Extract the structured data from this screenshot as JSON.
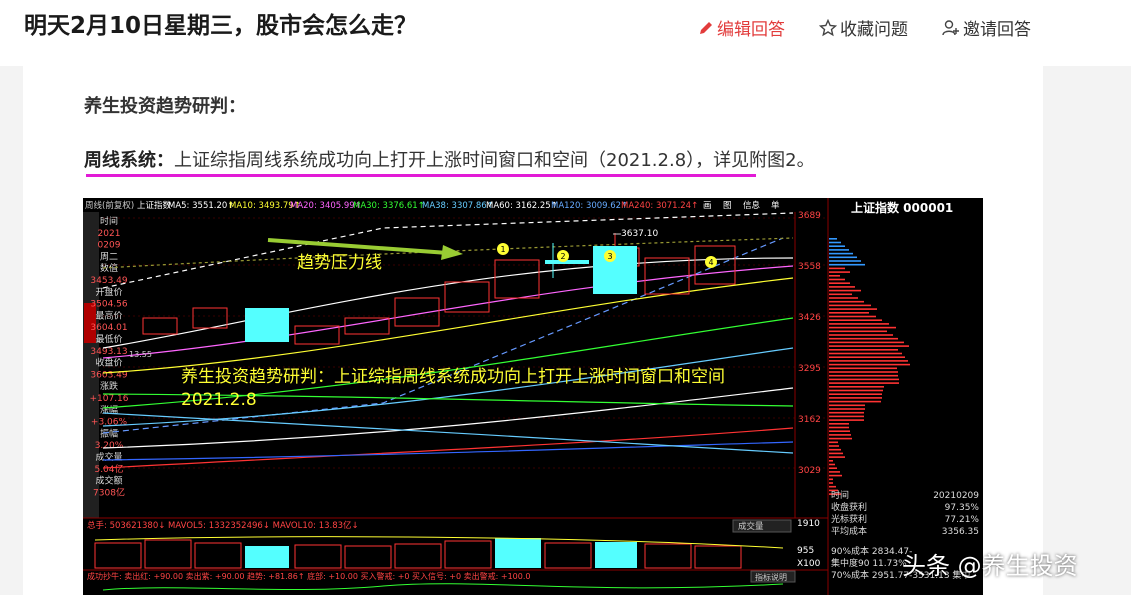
{
  "question": {
    "title": "明天2月10日星期三，股市会怎么走？"
  },
  "actions": {
    "edit": "编辑回答",
    "collect": "收藏问题",
    "invite": "邀请回答"
  },
  "article": {
    "heading": "养生投资趋势研判：",
    "line_bold": "周线系统：",
    "line_text": "上证综指周线系统成功向上打开上涨时间窗口和空间（2021.2.8）",
    "line_tail": "，详见附图2。"
  },
  "chart": {
    "header_left": "周线(前复权)",
    "header_name": "上证指数",
    "ma": [
      "MA5: 3551.20↑",
      "MA10: 3493.79↑",
      "MA20: 3405.99↑",
      "MA30: 3376.61↑",
      "MA38: 3307.86↑",
      "MA60: 3162.25↑",
      "MA120: 3009.62↑",
      "MA240: 3071.24↑"
    ],
    "tabs": [
      "画",
      "图",
      "信息",
      "单"
    ],
    "side_info": [
      "时间",
      "2021",
      "0209",
      "周二",
      "数值",
      "3453.49",
      "开盘价",
      "3504.56",
      "最高价",
      "3604.01",
      "最低价",
      "3493.13",
      "收盘价",
      "3603.49",
      "涨跌",
      "+107.16",
      "涨幅",
      "+3.06%",
      "振幅",
      "3.20%",
      "成交量",
      "5.04亿",
      "成交额",
      "7308亿"
    ],
    "y_ticks": [
      "3689",
      "3558",
      "3426",
      "3295",
      "3162",
      "3029"
    ],
    "price_label": "3637.10",
    "low_label": "13.55",
    "trend_label": "趋势压力线",
    "overlay_line1": "养生投资趋势研判：上证综指周线系统成功向上打开上涨时间窗口和空间",
    "overlay_line2": "2021.2.8",
    "markers": [
      "1",
      "2",
      "3",
      "4"
    ],
    "vol_header": "总手: 503621380↓  MAVOL5: 1332352496↓  MAVOL10: 13.83亿↓",
    "vol_box": "成交量",
    "vol_ticks": [
      "1910",
      "955",
      "X100"
    ],
    "ind_header": "成功抄牛: 卖出红: +90.00  卖出紫: +90.00  趋势: +81.86↑  底部: +10.00  买入警戒: +0  买入信号: +0  卖出警戒: +100.0",
    "ind_box": "指标说明",
    "right_title": "上证指数 000001",
    "stats": [
      {
        "k": "时间",
        "v": "20210209"
      },
      {
        "k": "收盘获利",
        "v": "97.35%"
      },
      {
        "k": "光标获利",
        "v": "77.21%"
      },
      {
        "k": "平均成本",
        "v": "3356.35"
      }
    ],
    "stats_more": [
      "90%成本 2834.47-",
      "集中度90 11.73%",
      "70%成本 2951.77-3531.13 集中"
    ]
  },
  "watermark": "头条 @养生投资",
  "colors": {
    "edit": "#e23c3c",
    "underline": "#e21ad6",
    "up": "#ff3232",
    "cyan": "#54ffff",
    "yellow": "#ffff33"
  }
}
